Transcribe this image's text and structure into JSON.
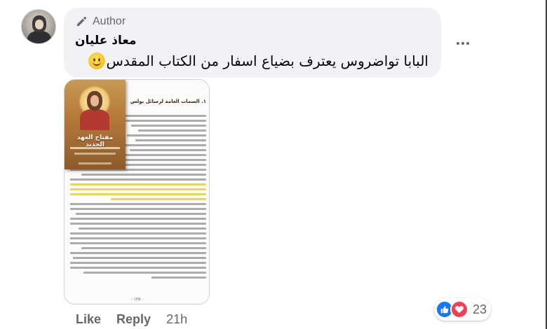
{
  "comment": {
    "author_badge": "Author",
    "author_name": "معاذ عليان",
    "text": "البابا تواضروس يعترف بضياع اسفار من الكتاب المقدس",
    "emoji": "slightly-smiling-face"
  },
  "attachment": {
    "book_title": "مفتاح العهد الجديد",
    "doc_heading": "١. السمات العامة لرسائل بولس",
    "page_number": "- ١٢٥ -"
  },
  "actions": {
    "like_label": "Like",
    "reply_label": "Reply",
    "time": "21h"
  },
  "reactions": {
    "types": [
      "like-icon",
      "love-icon"
    ],
    "count": "23"
  },
  "colors": {
    "bubble": "#f0f2f5",
    "secondary_text": "#65676b",
    "like_blue": "#1877f2",
    "love_red": "#f33e58"
  }
}
